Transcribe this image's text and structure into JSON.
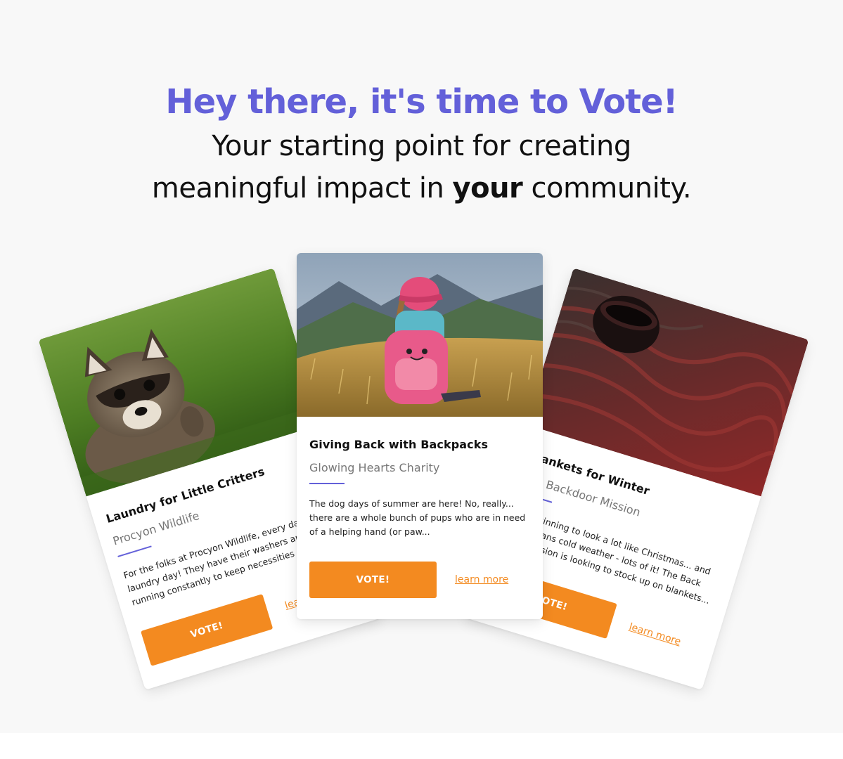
{
  "colors": {
    "accent": "#6360d9",
    "button": "#f38a20",
    "link": "#f38a20",
    "panel_bg": "#f8f8f8"
  },
  "hero": {
    "heading": "Hey there, it's time to Vote!",
    "sub_line1": "Your starting point for creating",
    "sub_line2_before": "meaningful impact in ",
    "sub_line2_bold": "your",
    "sub_line2_after": " community."
  },
  "cards": [
    {
      "title": "Laundry for Little Critters",
      "org": "Procyon Wildlife",
      "description": "For the folks at Procyon Wildlife, every day is laundry day! They have their washers and dryers running constantly to keep necessities clean.",
      "vote_label": "VOTE!",
      "learn_label": "learn more",
      "image_icon": "raccoon-photo"
    },
    {
      "title": "Giving Back with Backpacks",
      "org": "Glowing Hearts Charity",
      "description": "The dog days of summer are here! No, really... there are a whole bunch of pups who are in need of a helping hand (or paw...",
      "vote_label": "VOTE!",
      "learn_label": "learn more",
      "image_icon": "child-with-backpack-photo"
    },
    {
      "title": "Blankets for Winter",
      "org": "The Backdoor Mission",
      "description": "It's beginning to look a lot like Christmas... and that means cold weather - lots of it! The Back Door Mission is looking to stock up on blankets...",
      "vote_label": "VOTE!",
      "learn_label": "learn more",
      "image_icon": "knit-blanket-and-mug-photo"
    }
  ]
}
